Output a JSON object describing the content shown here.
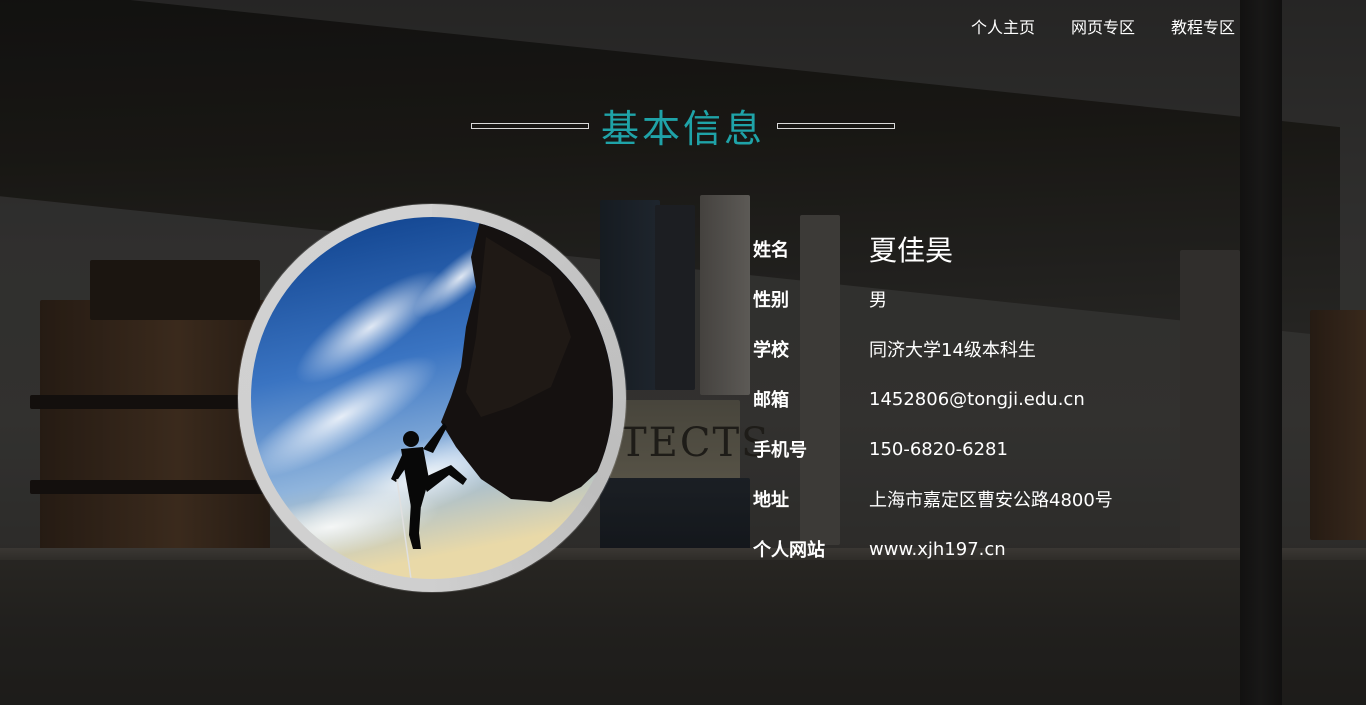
{
  "nav": {
    "items": [
      "个人主页",
      "网页专区",
      "教程专区"
    ]
  },
  "section": {
    "title": "基本信息"
  },
  "profile": {
    "rows": [
      {
        "label": "姓名",
        "value": "夏佳昊"
      },
      {
        "label": "性别",
        "value": "男"
      },
      {
        "label": "学校",
        "value": "同济大学14级本科生"
      },
      {
        "label": "邮箱",
        "value": "1452806@tongji.edu.cn"
      },
      {
        "label": "手机号",
        "value": "150-6820-6281"
      },
      {
        "label": "地址",
        "value": "上海市嘉定区曹安公路4800号"
      },
      {
        "label": "个人网站",
        "value": "www.xjh197.cn"
      }
    ]
  },
  "background": {
    "book_spine_text": "TECTS"
  },
  "colors": {
    "title_accent": "#1fa3a8",
    "text": "#ffffff",
    "ring": "#cfcfcf"
  }
}
